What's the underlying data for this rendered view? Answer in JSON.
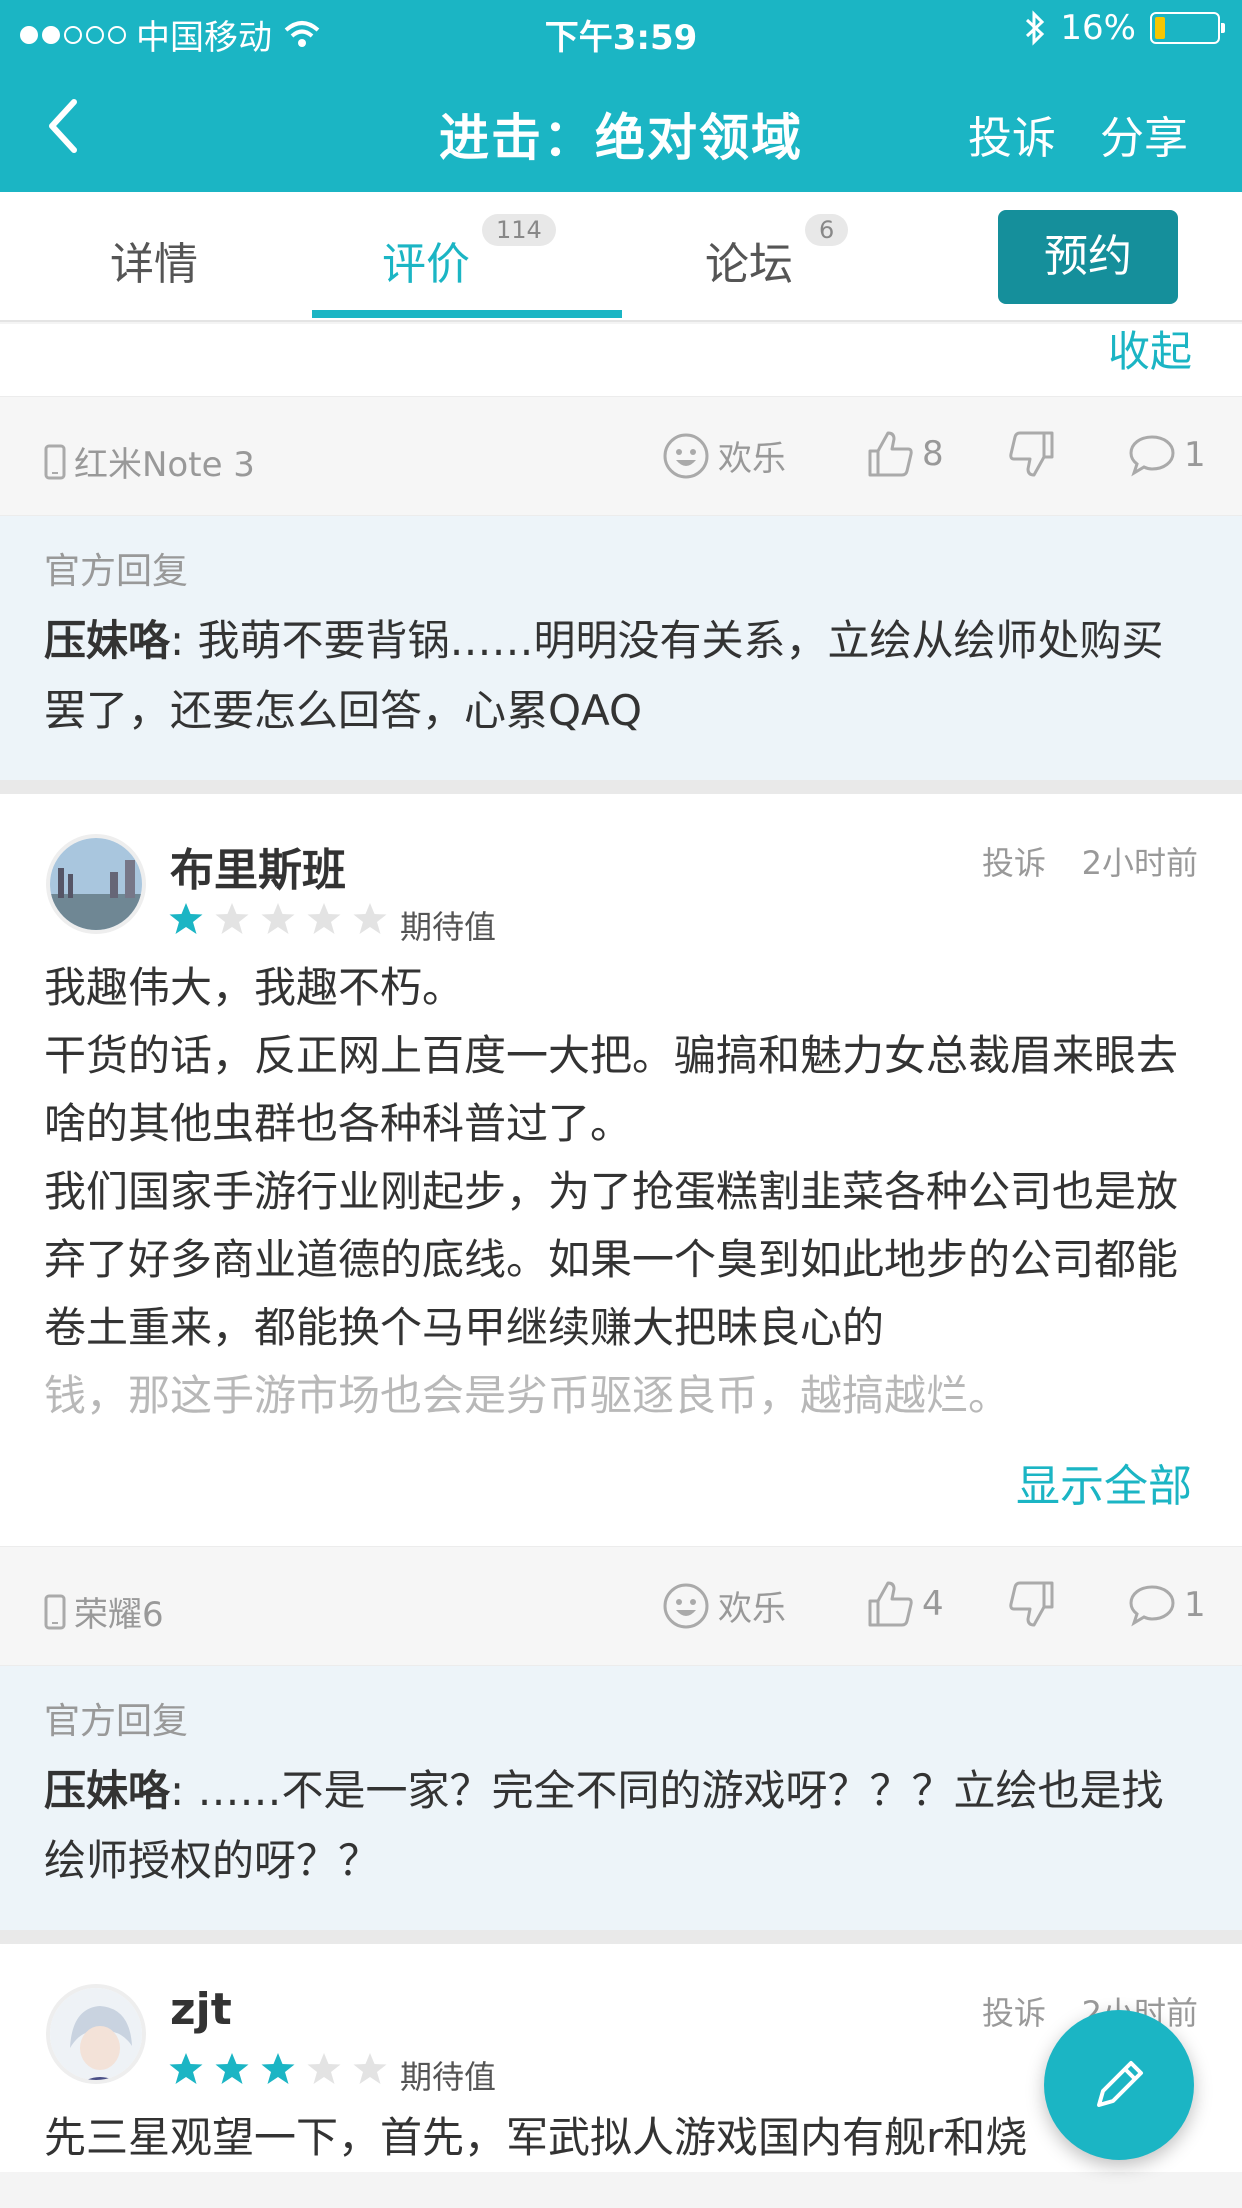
{
  "status_bar": {
    "carrier": "中国移动",
    "time": "下午3:59",
    "battery": "16%"
  },
  "nav": {
    "title": "进击：绝对领域",
    "report": "投诉",
    "share": "分享"
  },
  "tabs": [
    {
      "label": "详情"
    },
    {
      "label": "评价",
      "badge": "114"
    },
    {
      "label": "论坛",
      "badge": "6"
    }
  ],
  "reserve_label": "预约",
  "collapse_label": "收起",
  "review1_meta": {
    "device": "红米Note 3",
    "mood": "欢乐",
    "likes": "8",
    "comments": "1"
  },
  "reply1": {
    "label": "官方回复",
    "author": "压妹咯",
    "text": ": 我萌不要背锅……明明没有关系，立绘从绘师处购买罢了，还要怎么回答，心累QAQ"
  },
  "review2": {
    "name": "布里斯班",
    "rating": 1,
    "expect": "期待值",
    "report": "投诉",
    "time": "2小时前",
    "lines": [
      "我趣伟大，我趣不朽。",
      "干货的话，反正网上百度一大把。骗搞和魅力女总裁眉来眼去啥的其他虫群也各种科普过了。",
      "我们国家手游行业刚起步，为了抢蛋糕割韭菜各种公司也是放弃了好多商业道德的底线。如果一个臭到如此地步的公司都能卷土重来，都能换个马甲继续赚大把昧良心的"
    ],
    "faded": "钱，那这手游市场也会是劣币驱逐良币，越搞越烂。",
    "show_all": "显示全部"
  },
  "review2_meta": {
    "device": "荣耀6",
    "mood": "欢乐",
    "likes": "4",
    "comments": "1"
  },
  "reply2": {
    "label": "官方回复",
    "author": "压妹咯",
    "text": ": ……不是一家？完全不同的游戏呀？？？立绘也是找绘师授权的呀？？"
  },
  "review3": {
    "name": "zjt",
    "rating": 3,
    "expect": "期待值",
    "report": "投诉",
    "time": "2小时前",
    "line": "先三星观望一下，首先，军武拟人游戏国内有舰r和烧"
  },
  "colors": {
    "accent": "#1bb5c4",
    "reserve": "#158f9b",
    "reply_bg": "#edf4f9"
  },
  "icons": [
    "back-icon",
    "wifi-icon",
    "bluetooth-icon",
    "phone-icon",
    "smile-icon",
    "thumbs-up-icon",
    "thumbs-down-icon",
    "comment-icon",
    "star-icon",
    "edit-icon"
  ]
}
